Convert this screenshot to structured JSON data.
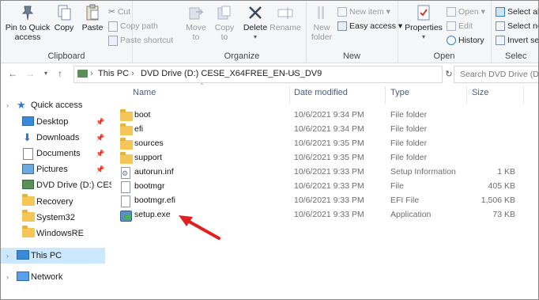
{
  "ribbon": {
    "clipboard": {
      "label": "Clipboard",
      "pin_label": "Pin to Quick\naccess",
      "copy_label": "Copy",
      "paste_label": "Paste",
      "cut_label": "Cut",
      "copy_path_label": "Copy path",
      "paste_shortcut_label": "Paste shortcut"
    },
    "organize": {
      "label": "Organize",
      "move_to_label": "Move\nto",
      "copy_to_label": "Copy\nto",
      "delete_label": "Delete",
      "rename_label": "Rename"
    },
    "new": {
      "label": "New",
      "new_folder_label": "New\nfolder",
      "new_item_label": "New item",
      "easy_access_label": "Easy access"
    },
    "open": {
      "label": "Open",
      "properties_label": "Properties",
      "open_label": "Open",
      "edit_label": "Edit",
      "history_label": "History"
    },
    "select": {
      "label": "Selec",
      "select_all_label": "Select all",
      "select_none_label": "Select no",
      "invert_label": "Invert se"
    }
  },
  "address": {
    "crumbs": [
      "This PC",
      "DVD Drive (D:) CESE_X64FREE_EN-US_DV9"
    ],
    "search_placeholder": "Search DVD Drive (D"
  },
  "nav": {
    "items": [
      {
        "label": "Quick access",
        "icon": "star-icon"
      },
      {
        "label": "Desktop",
        "icon": "desktop-icon",
        "pinned": true
      },
      {
        "label": "Downloads",
        "icon": "download-icon",
        "pinned": true
      },
      {
        "label": "Documents",
        "icon": "documents-icon",
        "pinned": true
      },
      {
        "label": "Pictures",
        "icon": "pictures-icon",
        "pinned": true
      },
      {
        "label": "DVD Drive (D:) CESE",
        "icon": "dvd-icon"
      },
      {
        "label": "Recovery",
        "icon": "folder-icon"
      },
      {
        "label": "System32",
        "icon": "folder-icon"
      },
      {
        "label": "WindowsRE",
        "icon": "folder-icon"
      },
      {
        "label": "This PC",
        "icon": "pc-icon",
        "selected": true
      },
      {
        "label": "Network",
        "icon": "network-icon"
      }
    ]
  },
  "columns": {
    "name": "Name",
    "date": "Date modified",
    "type": "Type",
    "size": "Size"
  },
  "files": [
    {
      "name": "boot",
      "date": "10/6/2021 9:34 PM",
      "type": "File folder",
      "size": "",
      "icon": "folder-icon"
    },
    {
      "name": "efi",
      "date": "10/6/2021 9:34 PM",
      "type": "File folder",
      "size": "",
      "icon": "folder-icon"
    },
    {
      "name": "sources",
      "date": "10/6/2021 9:35 PM",
      "type": "File folder",
      "size": "",
      "icon": "folder-icon"
    },
    {
      "name": "support",
      "date": "10/6/2021 9:35 PM",
      "type": "File folder",
      "size": "",
      "icon": "folder-icon"
    },
    {
      "name": "autorun.inf",
      "date": "10/6/2021 9:33 PM",
      "type": "Setup Information",
      "size": "1 KB",
      "icon": "setup-info-icon"
    },
    {
      "name": "bootmgr",
      "date": "10/6/2021 9:33 PM",
      "type": "File",
      "size": "405 KB",
      "icon": "file-icon"
    },
    {
      "name": "bootmgr.efi",
      "date": "10/6/2021 9:33 PM",
      "type": "EFI File",
      "size": "1,506 KB",
      "icon": "file-icon"
    },
    {
      "name": "setup.exe",
      "date": "10/6/2021 9:33 PM",
      "type": "Application",
      "size": "73 KB",
      "icon": "setup-exe-icon"
    }
  ],
  "colors": {
    "selection": "#cce8ff",
    "folder": "#f4c657",
    "accent": "#0078d7",
    "arrow": "#e02020"
  }
}
